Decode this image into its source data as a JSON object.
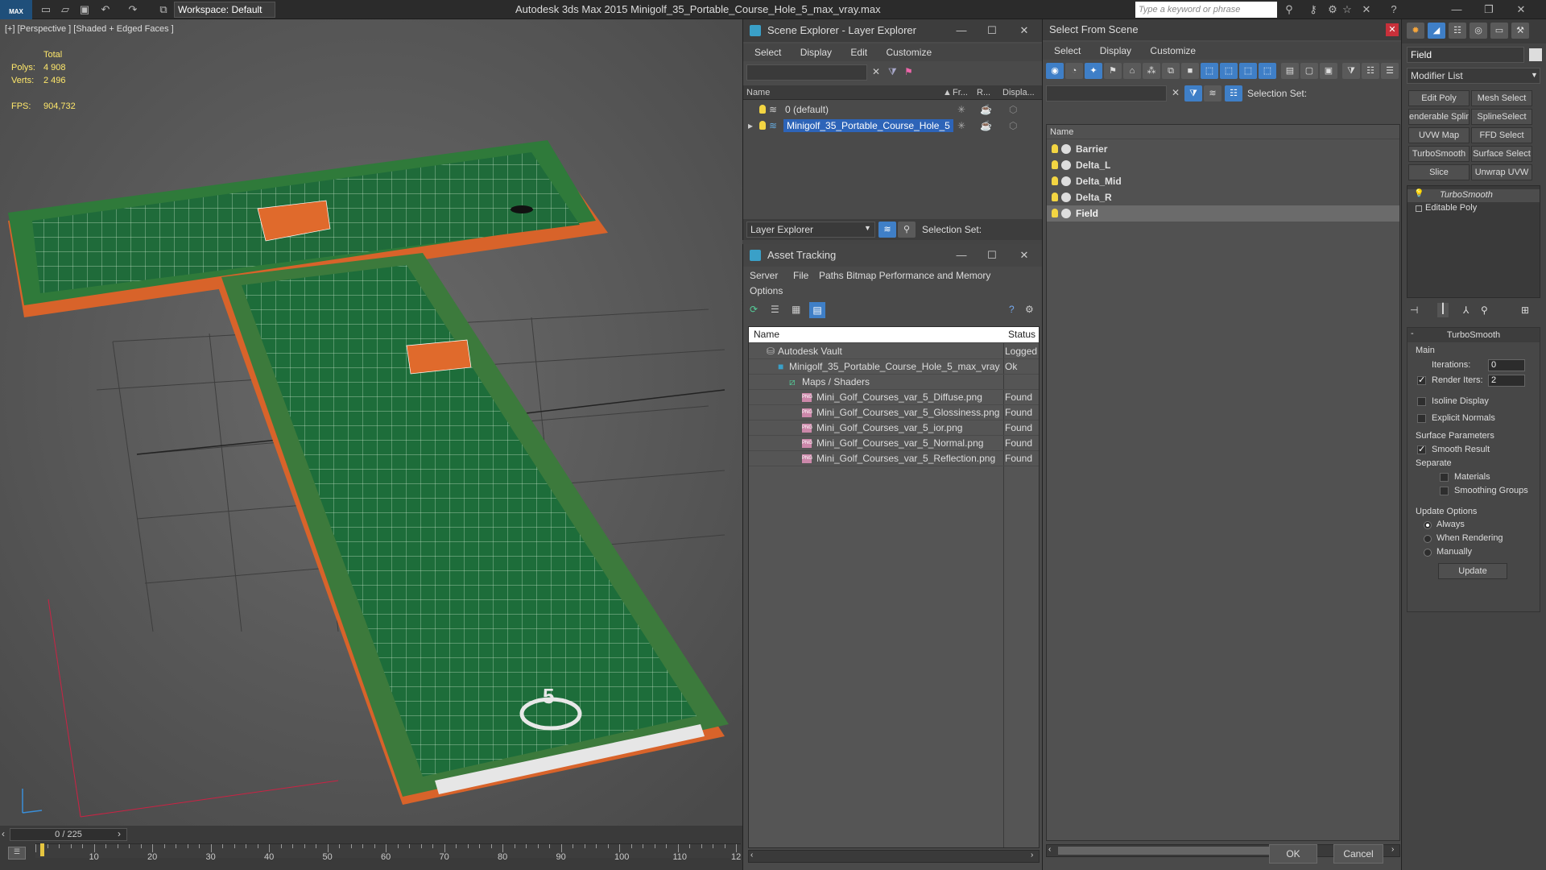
{
  "titlebar": {
    "logo": "MAX",
    "workspace": "Workspace: Default",
    "app_title": "Autodesk 3ds Max  2015      Minigolf_35_Portable_Course_Hole_5_max_vray.max",
    "search_placeholder": "Type a keyword or phrase"
  },
  "viewport": {
    "label": "[+] [Perspective ] [Shaded + Edged Faces ]",
    "stats": {
      "total_label": "Total",
      "polys_label": "Polys:",
      "polys_value": "4 908",
      "verts_label": "Verts:",
      "verts_value": "2 496",
      "fps_label": "FPS:",
      "fps_value": "904,732"
    },
    "hole_number": "5"
  },
  "timeline": {
    "frame": "0 / 225",
    "ticks": [
      "10",
      "20",
      "30",
      "40",
      "50",
      "60",
      "70",
      "80",
      "90",
      "100",
      "110",
      "12"
    ]
  },
  "scene_explorer": {
    "title": "Scene Explorer - Layer Explorer",
    "menu": [
      "Select",
      "Display",
      "Edit",
      "Customize"
    ],
    "columns": [
      "Name",
      "Fr...",
      "R...",
      "Displa..."
    ],
    "rows": [
      {
        "name": "0 (default)",
        "selected": false
      },
      {
        "name": "Minigolf_35_Portable_Course_Hole_5",
        "selected": true
      }
    ],
    "footer_dropdown": "Layer Explorer",
    "selection_set_label": "Selection Set:"
  },
  "asset_tracking": {
    "title": "Asset Tracking",
    "menu": [
      "Server",
      "File",
      "Paths",
      "Bitmap Performance and Memory"
    ],
    "menu2": [
      "Options"
    ],
    "columns": [
      "Name",
      "Status"
    ],
    "rows": [
      {
        "name": "Autodesk Vault",
        "status": "Logged"
      },
      {
        "name": "Minigolf_35_Portable_Course_Hole_5_max_vray...",
        "status": "Ok"
      },
      {
        "name": "Maps / Shaders",
        "status": ""
      },
      {
        "name": "Mini_Golf_Courses_var_5_Diffuse.png",
        "status": "Found"
      },
      {
        "name": "Mini_Golf_Courses_var_5_Glossiness.png",
        "status": "Found"
      },
      {
        "name": "Mini_Golf_Courses_var_5_ior.png",
        "status": "Found"
      },
      {
        "name": "Mini_Golf_Courses_var_5_Normal.png",
        "status": "Found"
      },
      {
        "name": "Mini_Golf_Courses_var_5_Reflection.png",
        "status": "Found"
      }
    ]
  },
  "select_from_scene": {
    "title": "Select From Scene",
    "menu": [
      "Select",
      "Display",
      "Customize"
    ],
    "selection_set_label": "Selection Set:",
    "column_name": "Name",
    "objects": [
      {
        "name": "Barrier",
        "selected": false
      },
      {
        "name": "Delta_L",
        "selected": false
      },
      {
        "name": "Delta_Mid",
        "selected": false
      },
      {
        "name": "Delta_R",
        "selected": false
      },
      {
        "name": "Field",
        "selected": true
      }
    ],
    "ok_label": "OK",
    "cancel_label": "Cancel"
  },
  "command_panel": {
    "object_name": "Field",
    "modifier_list": "Modifier List",
    "modifier_buttons": [
      "Edit Poly",
      "Mesh Select",
      "enderable Splin",
      "SplineSelect",
      "UVW Map",
      "FFD Select",
      "TurboSmooth",
      "Surface Select",
      "Slice",
      "Unwrap UVW"
    ],
    "stack": [
      "TurboSmooth",
      "Editable Poly"
    ],
    "rollout_title": "TurboSmooth",
    "main_label": "Main",
    "iterations_label": "Iterations:",
    "iterations_value": "0",
    "render_iters_label": "Render Iters:",
    "render_iters_value": "2",
    "isoline_label": "Isoline Display",
    "explicit_normals_label": "Explicit Normals",
    "surface_params_label": "Surface Parameters",
    "smooth_result_label": "Smooth Result",
    "separate_label": "Separate",
    "materials_label": "Materials",
    "smoothing_groups_label": "Smoothing Groups",
    "update_options_label": "Update Options",
    "always_label": "Always",
    "when_rendering_label": "When Rendering",
    "manually_label": "Manually",
    "update_button": "Update"
  }
}
